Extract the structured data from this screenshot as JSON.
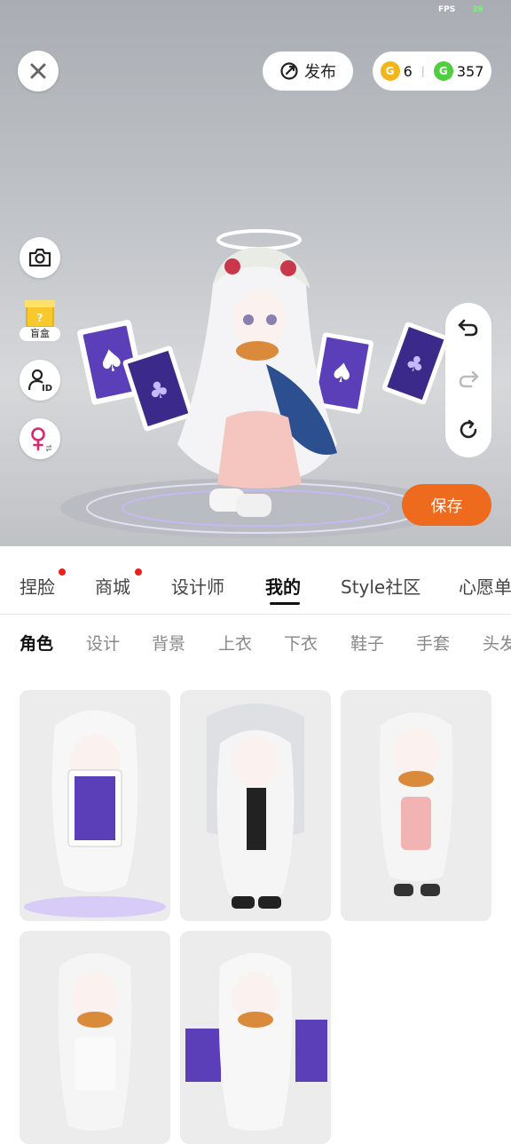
{
  "status": {
    "fps_label": "FPS",
    "fps_value": "39"
  },
  "top": {
    "publish_label": "发布",
    "gold_coins": "6",
    "green_coins": "357"
  },
  "side": {
    "blind_box_label": "盲盒"
  },
  "actions": {
    "save_label": "保存"
  },
  "main_tabs": [
    {
      "label": "捏脸",
      "dot": true
    },
    {
      "label": "商城",
      "dot": true
    },
    {
      "label": "设计师",
      "dot": false
    },
    {
      "label": "我的",
      "dot": false,
      "active": true
    },
    {
      "label": "Style社区",
      "dot": false
    },
    {
      "label": "心愿单",
      "dot": false
    }
  ],
  "sub_tabs": [
    {
      "label": "角色",
      "active": true
    },
    {
      "label": "设计"
    },
    {
      "label": "背景"
    },
    {
      "label": "上衣"
    },
    {
      "label": "下衣"
    },
    {
      "label": "鞋子"
    },
    {
      "label": "手套"
    },
    {
      "label": "头发"
    }
  ],
  "colors": {
    "accent": "#ee6a1d",
    "notification_dot": "#e8221d",
    "card_purple": "#5a3fb8"
  }
}
